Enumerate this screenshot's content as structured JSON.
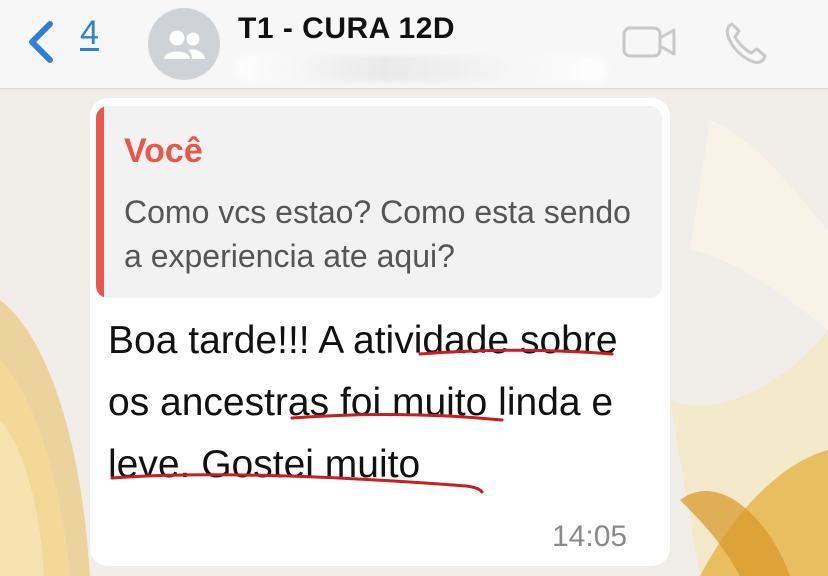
{
  "header": {
    "back_count": "4",
    "title": "T1 - CURA 12D"
  },
  "quote": {
    "author": "Você",
    "text": "Como vcs estao? Como esta sendo a experiencia ate aqui?"
  },
  "message": {
    "text": "Boa tarde!!! A atividade sobre os ancestras foi muito linda e leve. Gostei muito",
    "time": "14:05"
  },
  "colors": {
    "accent": "#2f7fd4",
    "quote_accent": "#e8574a",
    "underline": "#c81e1e"
  },
  "icons": {
    "back": "chevron-left-icon",
    "avatar": "group-icon",
    "video": "video-camera-icon",
    "phone": "phone-icon"
  }
}
